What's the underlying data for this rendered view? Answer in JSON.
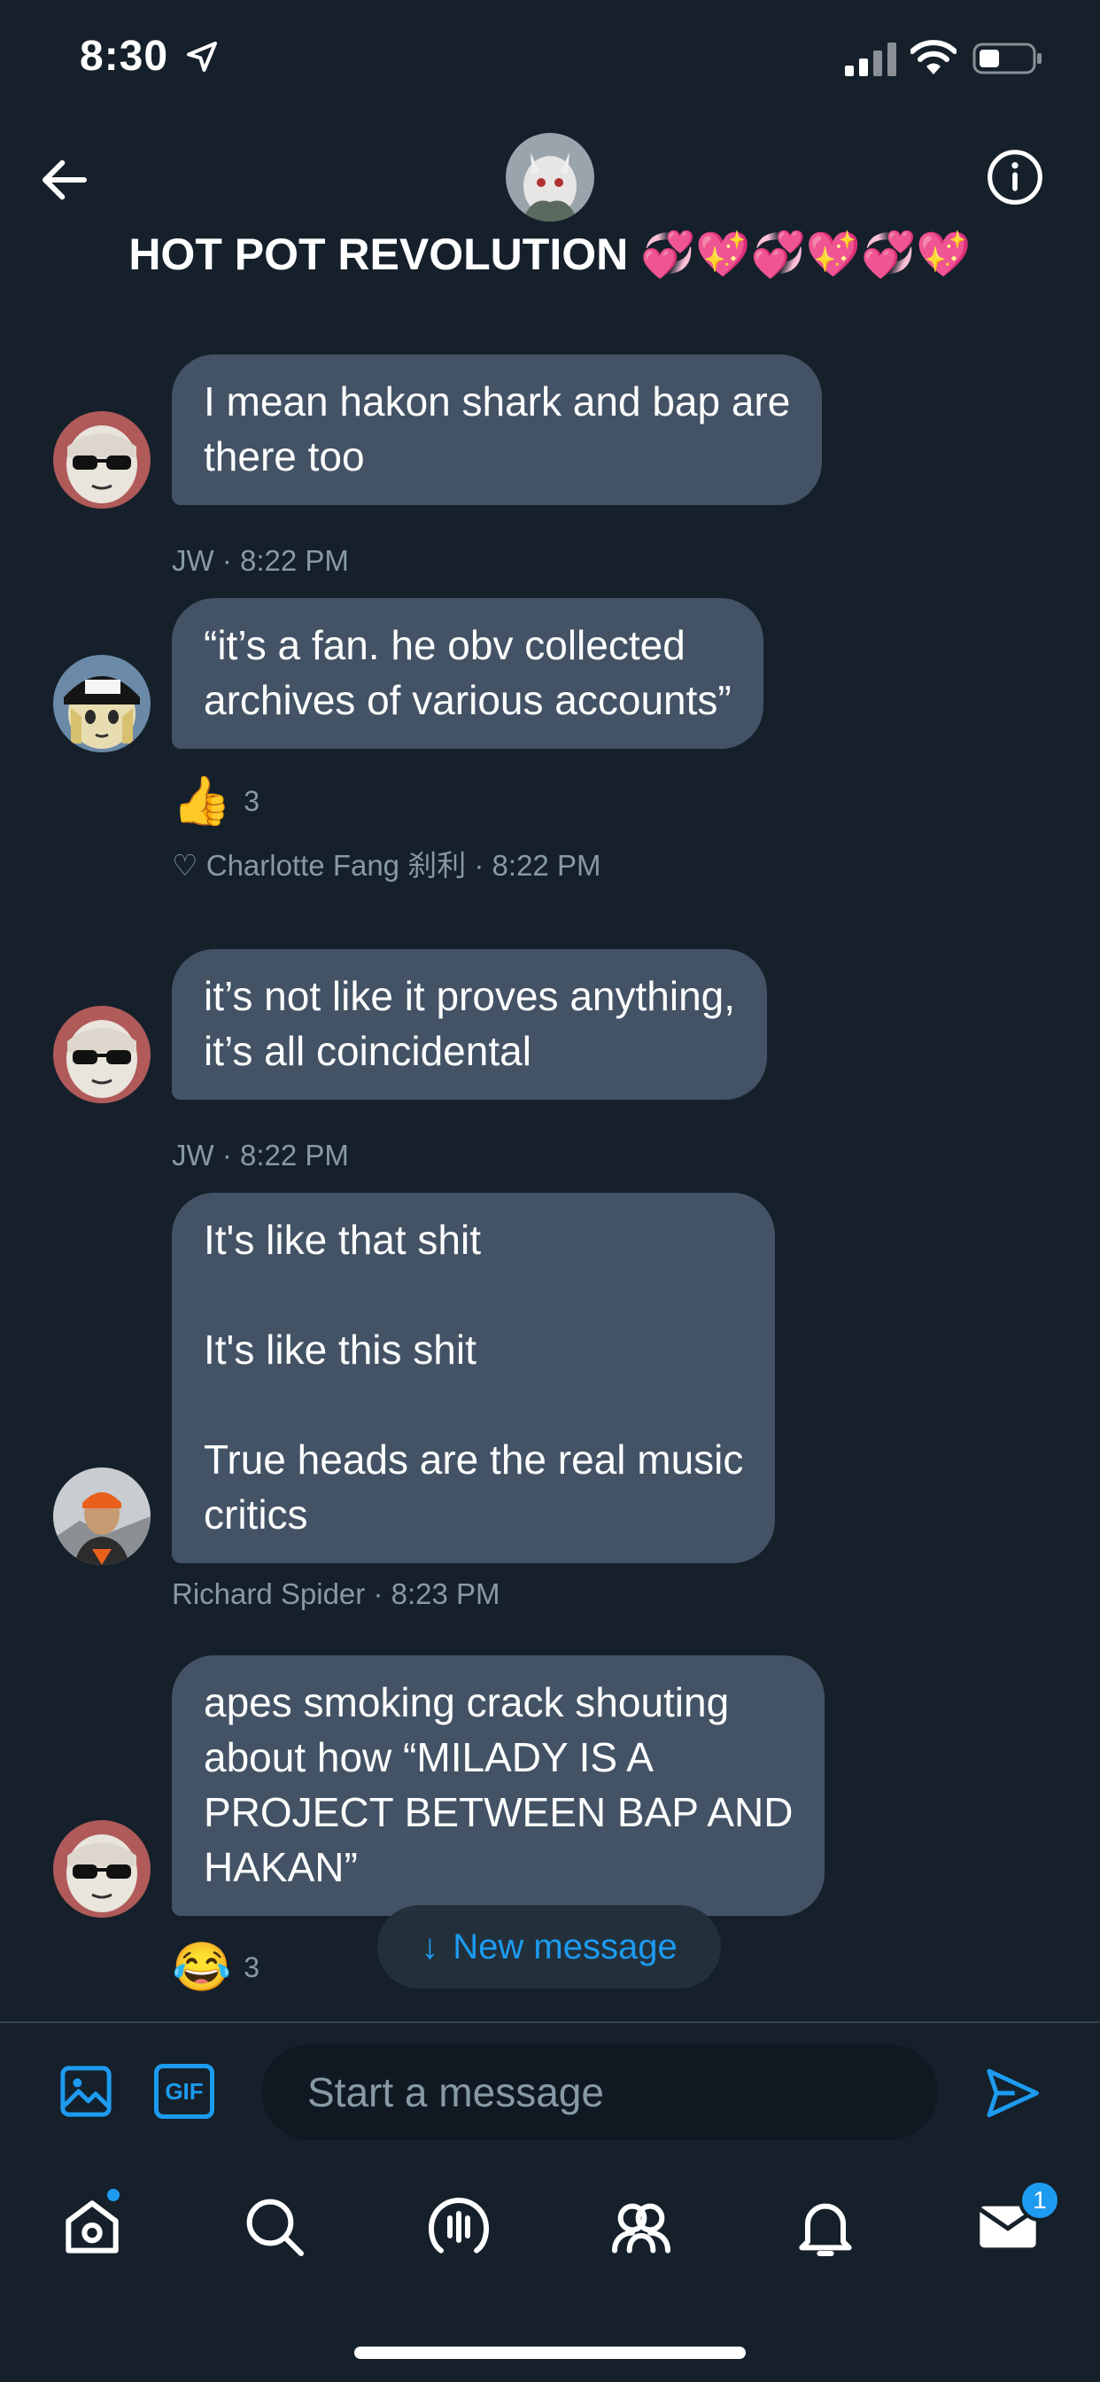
{
  "status_bar": {
    "time": "8:30"
  },
  "header": {
    "title": "HOT POT REVOLUTION 💞💖💞💖💞💖"
  },
  "messages": [
    {
      "text": "I mean hakon shark and bap are\nthere too",
      "sender": "JW",
      "time": "8:22 PM"
    },
    {
      "text": "“it’s a fan. he obv collected\narchives of various accounts”",
      "reaction": {
        "emoji": "👍",
        "count": "3"
      },
      "liked_by": "♡ Charlotte Fang 刹利",
      "time": "8:22 PM"
    },
    {
      "text": "it’s not like it proves anything,\nit’s all coincidental",
      "sender": "JW",
      "time": "8:22 PM"
    },
    {
      "text": "It's like that shit\n\nIt's like this shit\n\nTrue heads are the real music\ncritics",
      "sender": "Richard Spider",
      "time": "8:23 PM"
    },
    {
      "text": "apes smoking crack shouting\nabout how “MILADY IS A\nPROJECT BETWEEN BAP AND\nHAKAN”",
      "reaction": {
        "emoji": "😂",
        "count": "3"
      }
    }
  ],
  "new_message_pill": {
    "label": "New message"
  },
  "composer": {
    "gif_label": "GIF",
    "placeholder": "Start a message"
  },
  "tabbar": {
    "messages_badge": "1"
  },
  "colors": {
    "accent": "#1d9bf0",
    "bubble": "#435365",
    "background": "#15202b",
    "muted": "#8899a6"
  },
  "icons": [
    "location-arrow-icon",
    "signal-icon",
    "wifi-icon",
    "battery-icon",
    "back-arrow-icon",
    "info-icon",
    "image-icon",
    "gif-icon",
    "send-icon",
    "home-icon",
    "search-icon",
    "spaces-icon",
    "communities-icon",
    "bell-icon",
    "mail-icon"
  ]
}
